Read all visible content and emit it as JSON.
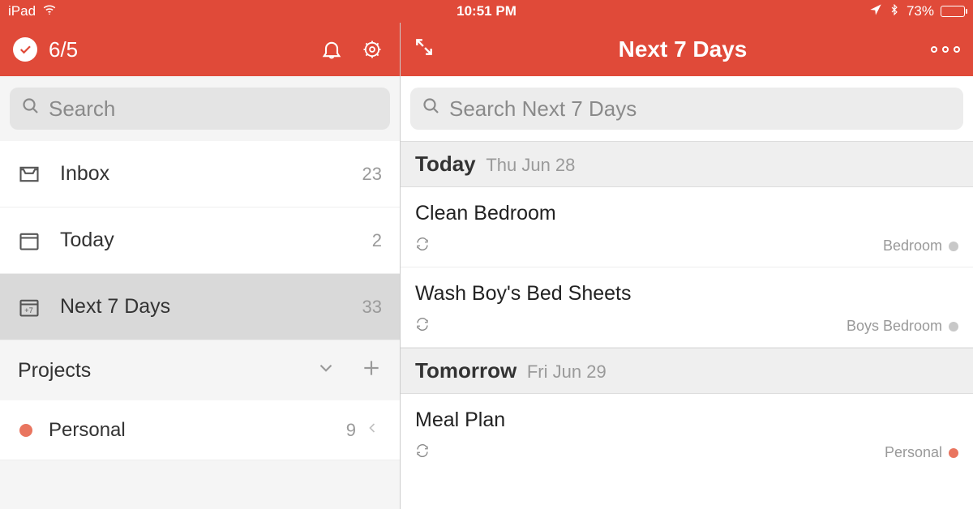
{
  "statusbar": {
    "device": "iPad",
    "time": "10:51 PM",
    "battery_pct": "73%",
    "battery_fill_css_width": "73%"
  },
  "left_header": {
    "karma": "6/5"
  },
  "left_search": {
    "placeholder": "Search"
  },
  "nav": {
    "items": [
      {
        "label": "Inbox",
        "count": "23",
        "selected": false
      },
      {
        "label": "Today",
        "count": "2",
        "selected": false
      },
      {
        "label": "Next 7 Days",
        "count": "33",
        "selected": true
      }
    ]
  },
  "projects": {
    "heading": "Projects",
    "items": [
      {
        "label": "Personal",
        "count": "9",
        "color": "#E9755F"
      }
    ]
  },
  "right_header": {
    "title": "Next 7 Days"
  },
  "right_search": {
    "placeholder": "Search Next 7 Days"
  },
  "sections": [
    {
      "title": "Today",
      "date": "Thu Jun 28",
      "tasks": [
        {
          "name": "Clean Bedroom",
          "recurring": true,
          "project": "Bedroom",
          "project_color": "#c8c8c8"
        },
        {
          "name": "Wash Boy's Bed Sheets",
          "recurring": true,
          "project": "Boys Bedroom",
          "project_color": "#c8c8c8"
        }
      ]
    },
    {
      "title": "Tomorrow",
      "date": "Fri Jun 29",
      "tasks": [
        {
          "name": "Meal Plan",
          "recurring": true,
          "project": "Personal",
          "project_color": "#E9755F"
        }
      ]
    }
  ]
}
